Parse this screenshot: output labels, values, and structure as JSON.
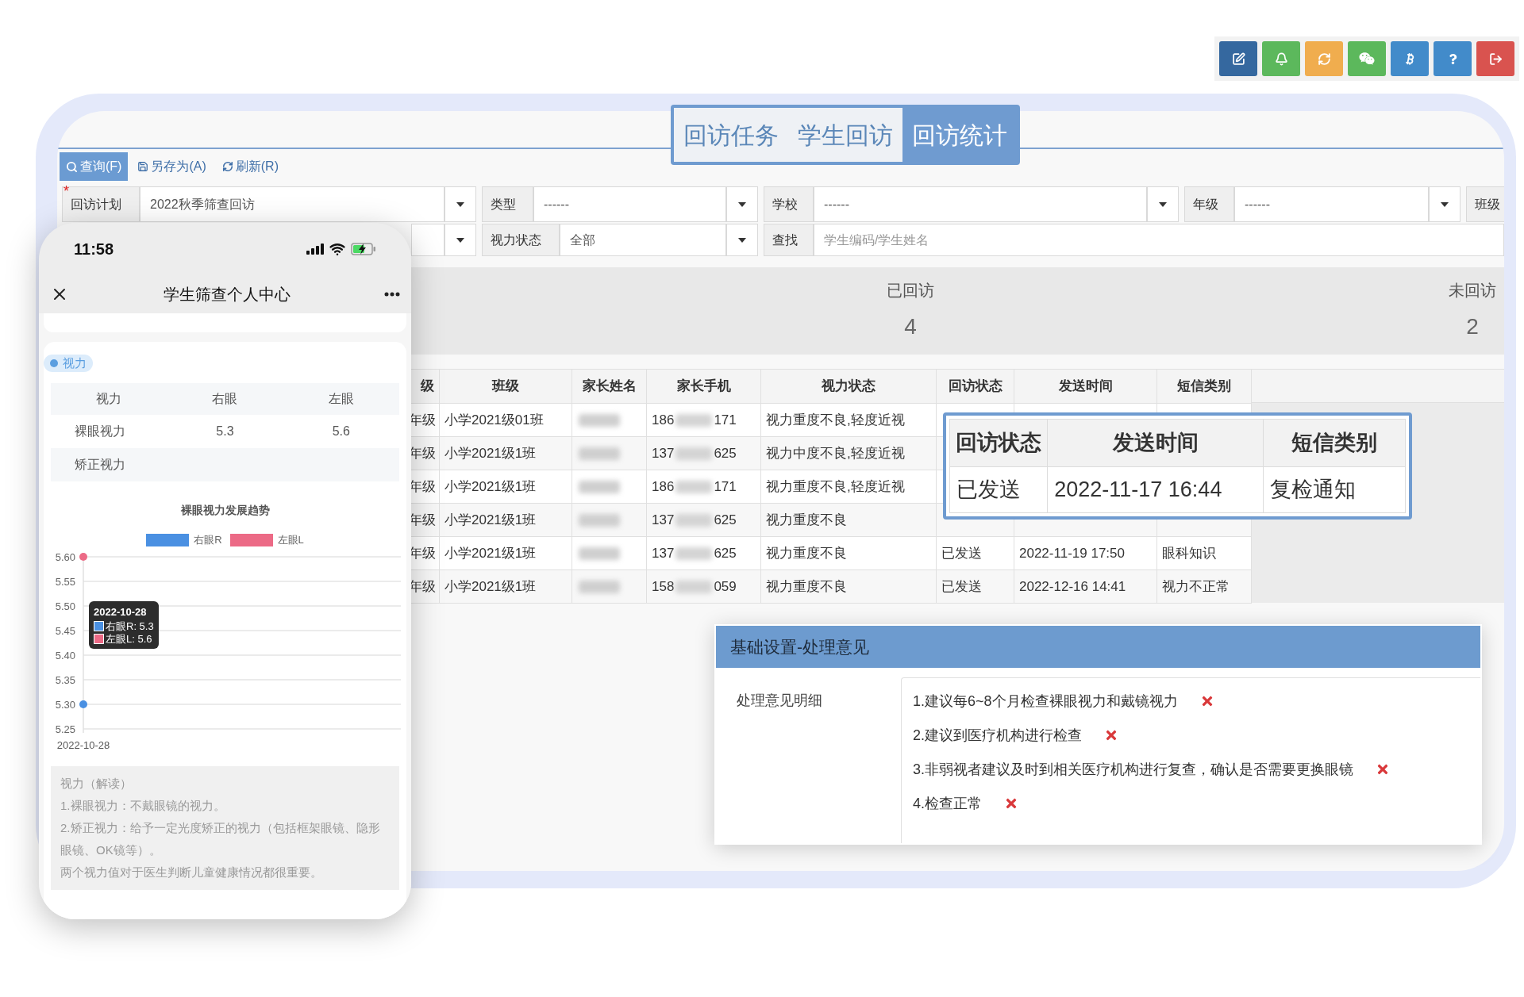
{
  "top_buttons": [
    {
      "kind": "edit",
      "color": "#35689f"
    },
    {
      "kind": "bell",
      "color": "#5cb85c"
    },
    {
      "kind": "refresh",
      "color": "#f0ad4e"
    },
    {
      "kind": "wechat",
      "color": "#5cb85c"
    },
    {
      "kind": "bitcoin",
      "color": "#428bca"
    },
    {
      "kind": "help",
      "color": "#428bca"
    },
    {
      "kind": "logout",
      "color": "#d9534f"
    }
  ],
  "tabs": [
    {
      "label": "回访任务",
      "selected": false
    },
    {
      "label": "学生回访",
      "selected": false
    },
    {
      "label": "回访统计",
      "selected": true
    }
  ],
  "actions": [
    {
      "kind": "search",
      "label": "查询(F)",
      "selected": true
    },
    {
      "kind": "save",
      "label": "另存为(A)",
      "selected": false
    },
    {
      "kind": "refresh",
      "label": "刷新(R)",
      "selected": false
    }
  ],
  "filters": [
    [
      {
        "kind": "select",
        "label": "回访计划",
        "value": "2022秋季筛查回访",
        "required_mark": "*"
      },
      {
        "kind": "select",
        "label": "类型",
        "value": "------"
      },
      {
        "kind": "select",
        "label": "学校",
        "value": "------"
      },
      {
        "kind": "select",
        "label": "年级",
        "value": "------"
      },
      {
        "kind": "label",
        "label": "班级"
      }
    ],
    [
      {
        "kind": "select"
      },
      {
        "kind": "select",
        "label": "视力状态",
        "value": "全部"
      },
      {
        "kind": "search",
        "label": "查找",
        "placeholder": "学生编码/学生姓名"
      }
    ]
  ],
  "stats": [
    {
      "label": "已回访",
      "value": "4"
    },
    {
      "label": "未回访",
      "value": "2"
    }
  ],
  "table": {
    "columns": [
      "级",
      "班级",
      "家长姓名",
      "家长手机",
      "视力状态",
      "回访状态",
      "发送时间",
      "短信类别"
    ],
    "rows": [
      {
        "grade": "年级",
        "class": "小学2021级01班",
        "phone_start": "186",
        "phone_end": "171",
        "vision": "视力重度不良,轻度近视"
      },
      {
        "grade": "年级",
        "class": "小学2021级1班",
        "phone_start": "137",
        "phone_end": "625",
        "vision": "视力中度不良,轻度近视"
      },
      {
        "grade": "年级",
        "class": "小学2021级1班",
        "phone_start": "186",
        "phone_end": "171",
        "vision": "视力重度不良,轻度近视"
      },
      {
        "grade": "年级",
        "class": "小学2021级1班",
        "phone_start": "137",
        "phone_end": "625",
        "vision": "视力重度不良"
      },
      {
        "grade": "年级",
        "class": "小学2021级1班",
        "phone_start": "137",
        "phone_end": "625",
        "vision": "视力重度不良",
        "status": "已发送",
        "sent": "2022-11-19 17:50",
        "sms": "眼科知识"
      },
      {
        "grade": "年级",
        "class": "小学2021级1班",
        "phone_start": "158",
        "phone_end": "059",
        "vision": "视力重度不良",
        "status": "已发送",
        "sent": "2022-12-16 14:41",
        "sms": "视力不正常"
      }
    ]
  },
  "popup": {
    "columns": [
      "回访状态",
      "发送时间",
      "短信类别"
    ],
    "row": [
      "已发送",
      "2022-11-17 16:44",
      "复检通知"
    ]
  },
  "panel": {
    "title": "基础设置-处理意见",
    "label": "处理意见明细",
    "items": [
      "1.建议每6~8个月检查裸眼视力和戴镜视力",
      "2.建议到医疗机构进行检查",
      "3.非弱视者建议及时到相关医疗机构进行复查，确认是否需要更换眼镜",
      "4.检查正常"
    ]
  },
  "phone": {
    "time": "11:58",
    "title": "学生筛查个人中心",
    "tag": "视力",
    "table": {
      "columns": [
        "视力",
        "右眼",
        "左眼"
      ],
      "rows": [
        [
          "裸眼视力",
          "5.3",
          "5.6"
        ],
        [
          "矫正视力"
        ]
      ]
    },
    "chart_data": {
      "type": "line",
      "title": "裸眼视力发展趋势",
      "grid": true,
      "categories": [
        "2022-10-28"
      ],
      "series": [
        {
          "name": "右眼R",
          "color": "#4a90e2",
          "marker": true,
          "values": [
            5.3
          ]
        },
        {
          "name": "左眼L",
          "color": "#ec6a86",
          "marker": true,
          "values": [
            5.6
          ]
        }
      ],
      "ylim": [
        5.25,
        5.6
      ],
      "yticks": [
        {
          "value": 5.25,
          "label": "5.25"
        },
        {
          "value": 5.3,
          "label": "5.30"
        },
        {
          "value": 5.35,
          "label": "5.35"
        },
        {
          "value": 5.4,
          "label": "5.40"
        },
        {
          "value": 5.45,
          "label": "5.45"
        },
        {
          "value": 5.5,
          "label": "5.50"
        },
        {
          "value": 5.55,
          "label": "5.55"
        },
        {
          "value": 5.6,
          "label": "5.60"
        }
      ]
    },
    "tooltip": {
      "title": "2022-10-28",
      "lines": [
        "右眼R: 5.3",
        "左眼L: 5.6"
      ]
    },
    "note": [
      "视力（解读）",
      "1.裸眼视力：不戴眼镜的视力。",
      "2.矫正视力：给予一定光度矫正的视力（包括框架眼镜、隐形眼镜、OK镜等）。",
      "两个视力值对于医生判断儿童健康情况都很重要。"
    ]
  }
}
